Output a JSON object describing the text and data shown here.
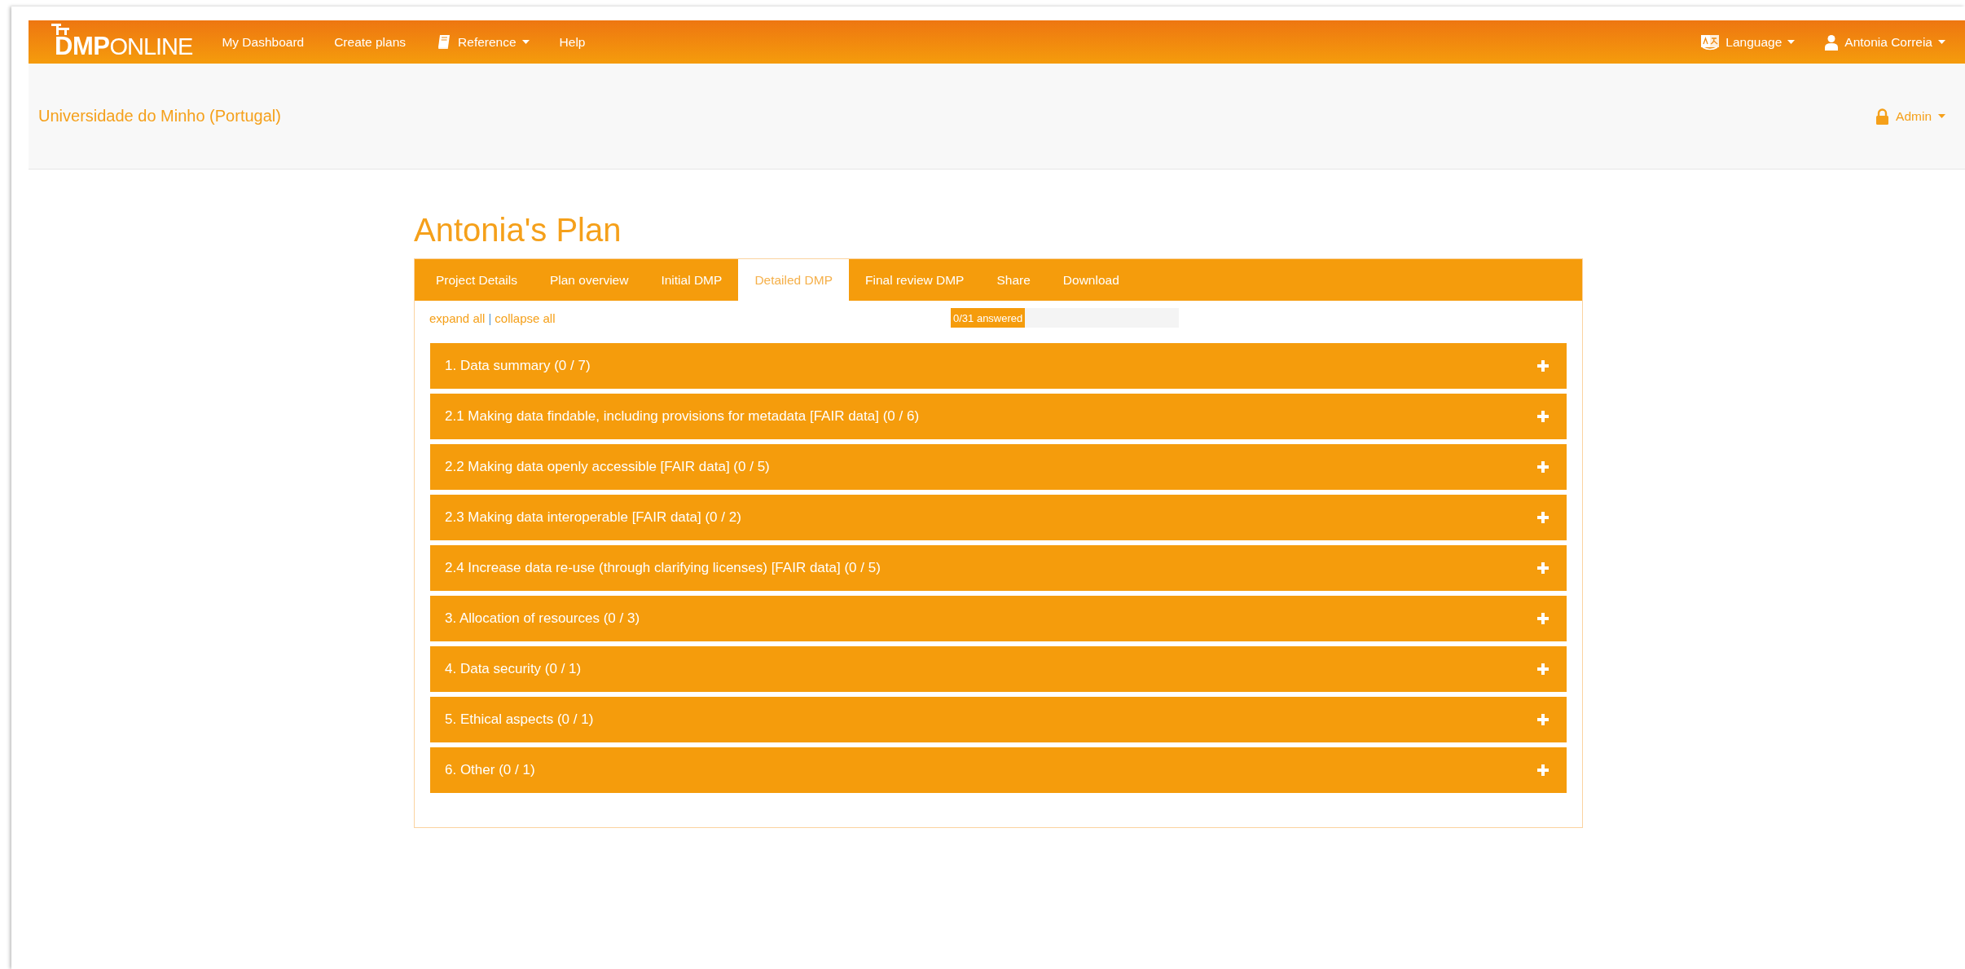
{
  "navbar": {
    "logo": {
      "bold": "DMP",
      "light": "ONLINE"
    },
    "items": [
      {
        "label": "My Dashboard",
        "kind": "link"
      },
      {
        "label": "Create plans",
        "kind": "link"
      },
      {
        "label": "Reference",
        "kind": "menu"
      },
      {
        "label": "Help",
        "kind": "link"
      }
    ],
    "language": {
      "label": "Language"
    },
    "user": {
      "label": "Antonia Correia"
    }
  },
  "subheader": {
    "organisation": "Universidade do Minho (Portugal)",
    "admin": {
      "label": "Admin"
    }
  },
  "plan": {
    "title": "Antonia's Plan",
    "tabs": [
      {
        "label": "Project Details",
        "selected": false
      },
      {
        "label": "Plan overview",
        "selected": false
      },
      {
        "label": "Initial DMP",
        "selected": false
      },
      {
        "label": "Detailed DMP",
        "selected": true
      },
      {
        "label": "Final review DMP",
        "selected": false
      },
      {
        "label": "Share",
        "selected": false
      },
      {
        "label": "Download",
        "selected": false
      }
    ],
    "expand_all": "expand all",
    "separator": "|",
    "collapse_all": "collapse all",
    "progress": {
      "label": "0/31 answered"
    },
    "sections": [
      {
        "title": "1. Data summary (0 / 7)",
        "expanded": false
      },
      {
        "title": "2.1 Making data findable, including provisions for metadata [FAIR data] (0 / 6)",
        "expanded": false
      },
      {
        "title": "2.2 Making data openly accessible [FAIR data] (0 / 5)",
        "expanded": false
      },
      {
        "title": "2.3 Making data interoperable [FAIR data] (0 / 2)",
        "expanded": false
      },
      {
        "title": "2.4 Increase data re-use (through clarifying licenses) [FAIR data] (0 / 5)",
        "expanded": false
      },
      {
        "title": "3. Allocation of resources (0 / 3)",
        "expanded": false
      },
      {
        "title": "4. Data security (0 / 1)",
        "expanded": false
      },
      {
        "title": "5. Ethical aspects (0 / 1)",
        "expanded": false
      },
      {
        "title": "6. Other (0 / 1)",
        "expanded": false
      }
    ]
  }
}
